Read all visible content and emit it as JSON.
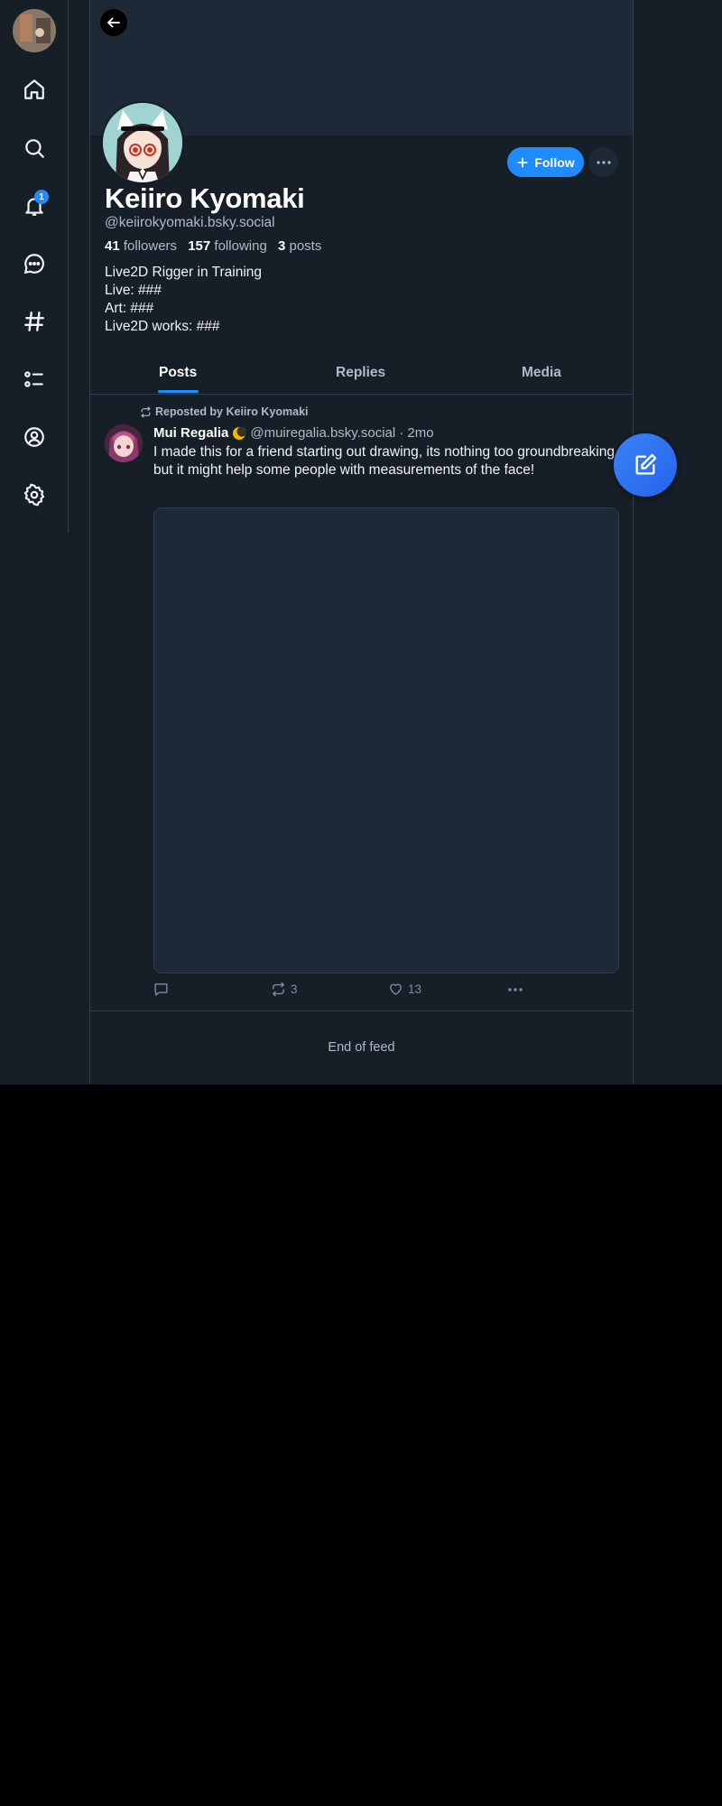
{
  "sidebar": {
    "notification_count": "1",
    "items": [
      {
        "icon": "home-icon"
      },
      {
        "icon": "search-icon"
      },
      {
        "icon": "bell-icon"
      },
      {
        "icon": "chat-icon"
      },
      {
        "icon": "hashtag-icon"
      },
      {
        "icon": "list-icon"
      },
      {
        "icon": "profile-icon"
      },
      {
        "icon": "gear-icon"
      }
    ]
  },
  "profile": {
    "display_name": "Keiiro Kyomaki",
    "handle": "@keiirokyomaki.bsky.social",
    "followers_count": "41",
    "followers_label": "followers",
    "following_count": "157",
    "following_label": "following",
    "posts_count": "3",
    "posts_label": "posts",
    "bio": [
      "Live2D Rigger in Training",
      "Live: ###",
      "Art: ###",
      "Live2D works: ###"
    ],
    "follow_label": "Follow"
  },
  "tabs": [
    {
      "label": "Posts",
      "active": true
    },
    {
      "label": "Replies",
      "active": false
    },
    {
      "label": "Media",
      "active": false
    }
  ],
  "post": {
    "repost_label": "Reposted by Keiiro Kyomaki",
    "author": "Mui Regalia",
    "handle": "@muiregalia.bsky.social",
    "time": "· 2mo",
    "text": "I made this for a friend starting out drawing, its nothing too groundbreaking, but it might help some people with measurements of the face!",
    "reposts": "3",
    "likes": "13"
  },
  "feed_end_label": "End of feed",
  "colors": {
    "accent": "#208bfe",
    "background": "#161e27",
    "border": "#2e4052"
  }
}
